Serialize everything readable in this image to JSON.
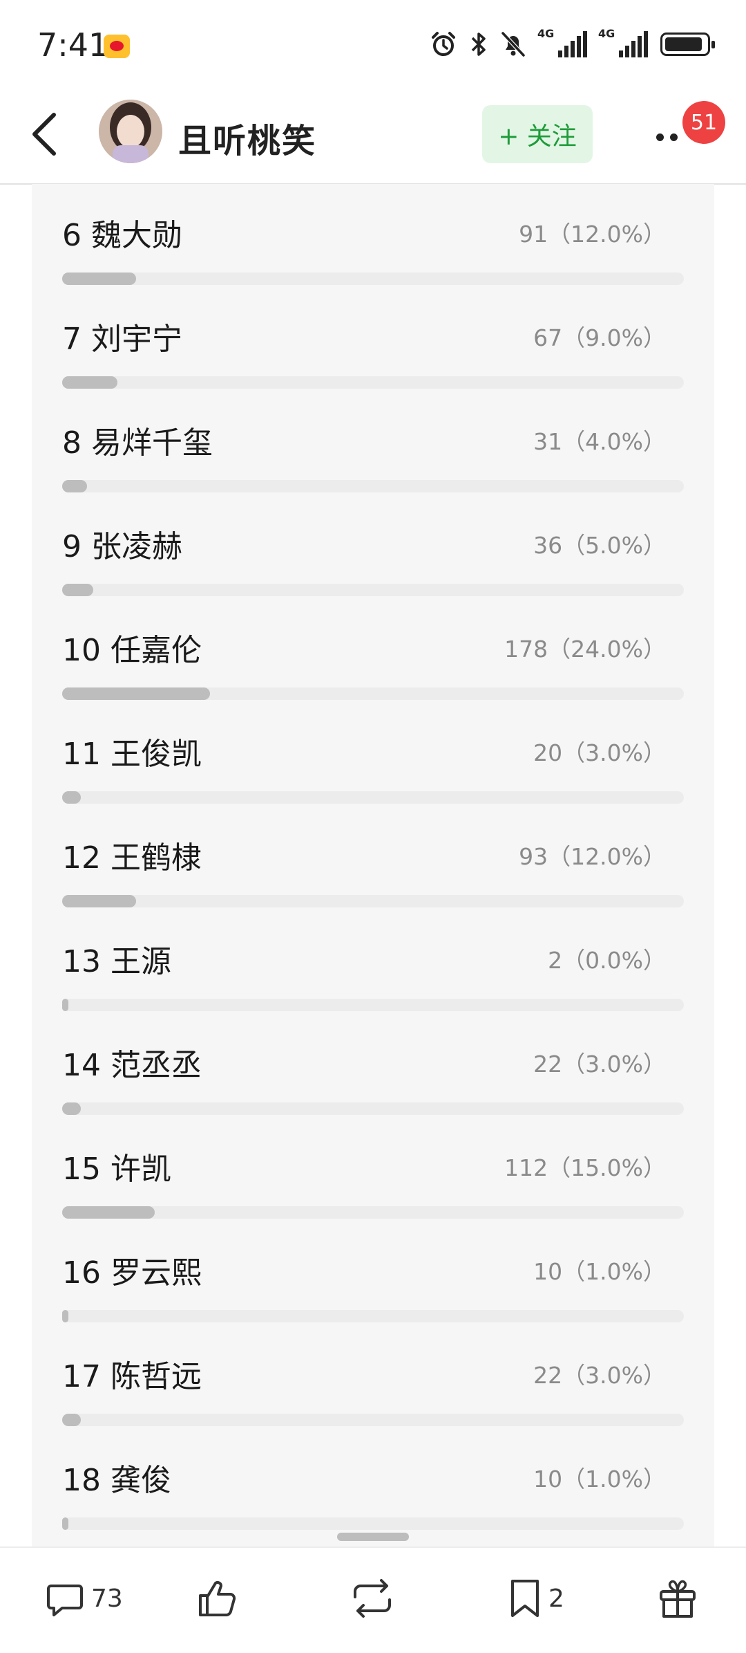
{
  "status_bar": {
    "time": "7:41",
    "network_1": "4G",
    "network_2": "4G",
    "icons": [
      "weibo-app-icon",
      "alarm-icon",
      "bluetooth-icon",
      "mute-bell-icon",
      "signal-icon",
      "signal-icon",
      "battery-icon"
    ]
  },
  "header": {
    "username": "且听桃笑",
    "follow_label": "+ 关注",
    "notification_count": "51"
  },
  "poll": {
    "options": [
      {
        "label": "6 魏大勋",
        "value": "91（12.0%）",
        "percent": 12.0
      },
      {
        "label": "7 刘宇宁",
        "value": "67（9.0%）",
        "percent": 9.0
      },
      {
        "label": "8 易烊千玺",
        "value": "31（4.0%）",
        "percent": 4.0
      },
      {
        "label": "9 张凌赫",
        "value": "36（5.0%）",
        "percent": 5.0
      },
      {
        "label": "10 任嘉伦",
        "value": "178（24.0%）",
        "percent": 24.0
      },
      {
        "label": "11 王俊凯",
        "value": "20（3.0%）",
        "percent": 3.0
      },
      {
        "label": "12 王鹤棣",
        "value": "93（12.0%）",
        "percent": 12.0
      },
      {
        "label": "13 王源",
        "value": "2（0.0%）",
        "percent": 0.0
      },
      {
        "label": "14 范丞丞",
        "value": "22（3.0%）",
        "percent": 3.0
      },
      {
        "label": "15 许凯",
        "value": "112（15.0%）",
        "percent": 15.0
      },
      {
        "label": "16 罗云熙",
        "value": "10（1.0%）",
        "percent": 1.0
      },
      {
        "label": "17 陈哲远",
        "value": "22（3.0%）",
        "percent": 3.0
      },
      {
        "label": "18 龚俊",
        "value": "10（1.0%）",
        "percent": 1.0
      }
    ]
  },
  "bottom_bar": {
    "comment_count": "73",
    "bookmark_count": "2"
  },
  "colors": {
    "follow_text": "#1f9c3a",
    "follow_bg": "#e3f6e6",
    "badge": "#ee4242",
    "bar_fill": "#bdbdbd",
    "bar_track": "#ececec"
  }
}
